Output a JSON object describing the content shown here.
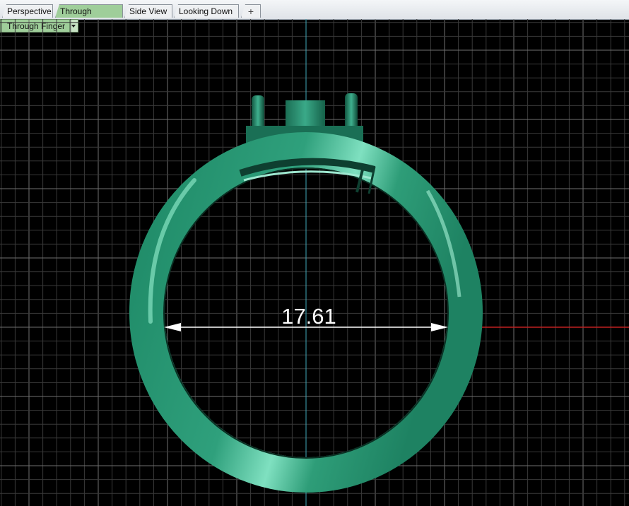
{
  "tabs": [
    {
      "label": "Perspective",
      "active": false
    },
    {
      "label": "Through Finger",
      "active": true
    },
    {
      "label": "Side View",
      "active": false
    },
    {
      "label": "Looking Down",
      "active": false
    }
  ],
  "add_tab_icon": "plus-icon",
  "viewport": {
    "name": "Through Finger",
    "dropdown_icon": "chevron-down-icon",
    "dimension_value": "17.61"
  },
  "colors": {
    "background": "#000000",
    "grid_minor": "#3a3a3a",
    "grid_major": "#6f6f6f",
    "axis_y": "#3fa7b8",
    "axis_x": "#c02020",
    "ring": "#2a9b78",
    "active_tab": "#9fce9a"
  }
}
